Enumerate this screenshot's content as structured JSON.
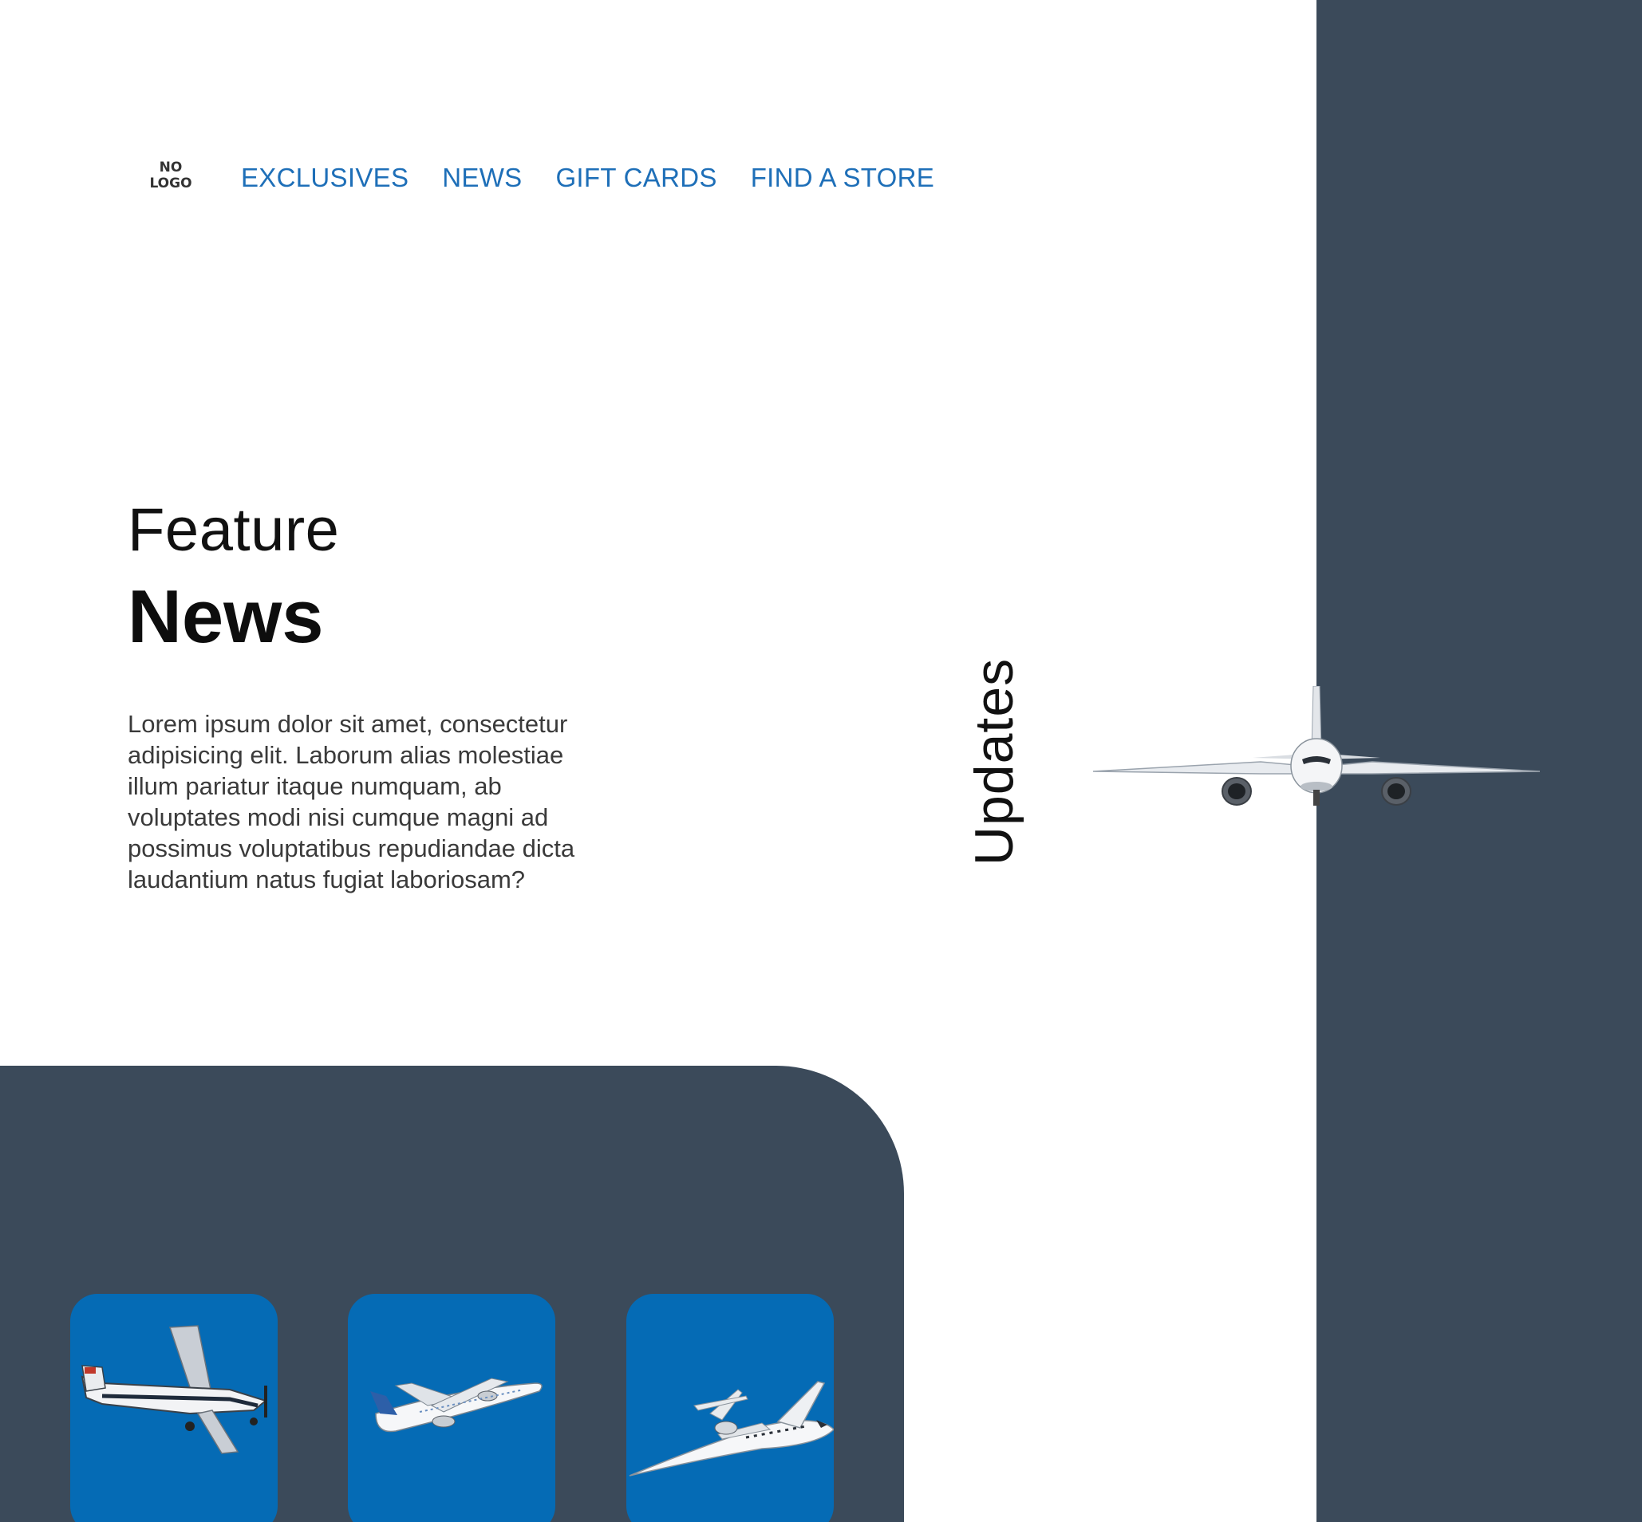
{
  "logo": {
    "line1": "NO",
    "line2": "LOGO"
  },
  "nav": {
    "items": [
      {
        "label": "EXCLUSIVES"
      },
      {
        "label": "NEWS"
      },
      {
        "label": "GIFT CARDS"
      },
      {
        "label": "FIND A STORE"
      }
    ]
  },
  "hero": {
    "eyebrow": "Feature",
    "title": "News",
    "body": "Lorem ipsum dolor sit amet, consectetur adipisicing elit. Laborum alias molestiae illum pariatur itaque numquam, ab voluptates modi nisi cumque magni ad possimus voluptatibus repudiandae dicta laudantium natus fugiat laboriosam?",
    "side_label": "Updates"
  },
  "colors": {
    "accent": "#1e6fb8",
    "dark_panel": "#3b4a5a",
    "card_blue": "#056bb5"
  },
  "cards": [
    {
      "image": "propeller-plane-icon"
    },
    {
      "image": "airliner-icon"
    },
    {
      "image": "private-jet-icon"
    }
  ]
}
